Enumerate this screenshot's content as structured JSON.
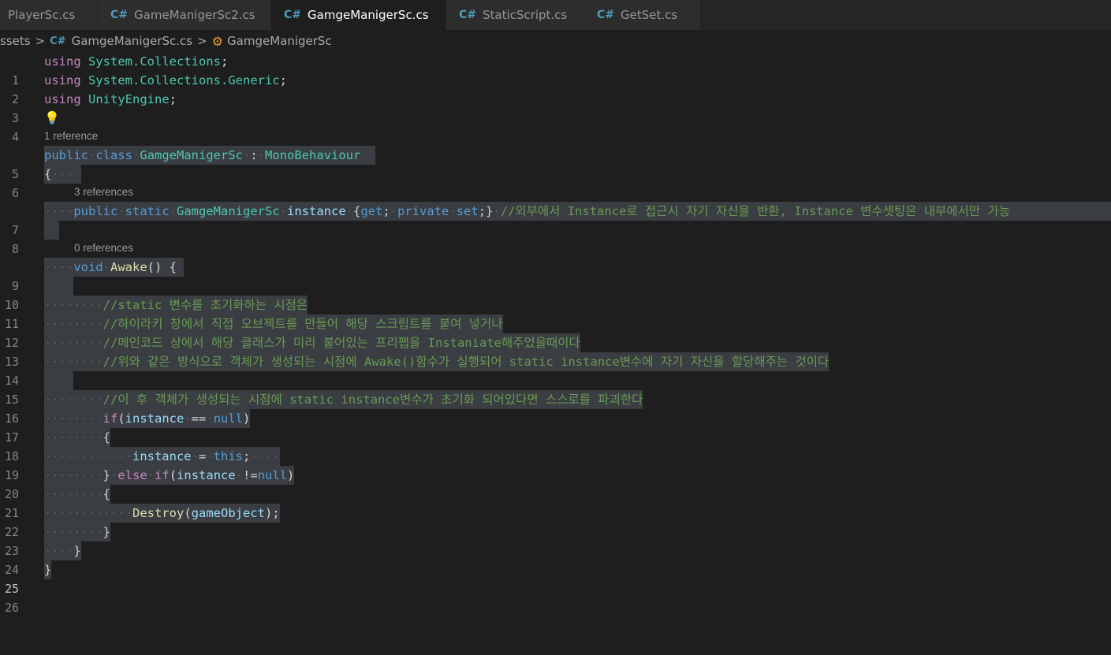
{
  "tabs": [
    {
      "label": "PlayerSc.cs",
      "active": false,
      "dirty": false
    },
    {
      "label": "GameManigerSc2.cs",
      "active": false,
      "dirty": true
    },
    {
      "label": "GamgeManigerSc.cs",
      "active": true,
      "dirty": true
    },
    {
      "label": "StaticScript.cs",
      "active": false,
      "dirty": true
    },
    {
      "label": "GetSet.cs",
      "active": false,
      "dirty": false
    }
  ],
  "file_icon": "C#",
  "breadcrumb": {
    "folder": "ssets",
    "file": "GamgeManigerSc.cs",
    "symbol": "GamgeManigerSc"
  },
  "codelens": {
    "class_refs": "1 reference",
    "instance_refs": "3 references",
    "awake_refs": "0 references"
  },
  "line_numbers": [
    "1",
    "2",
    "3",
    "4",
    "5",
    "6",
    "7",
    "8",
    "9",
    "10",
    "11",
    "12",
    "13",
    "14",
    "15",
    "16",
    "17",
    "18",
    "19",
    "20",
    "21",
    "22",
    "23",
    "24",
    "25",
    "26"
  ],
  "current_line": "25",
  "code": {
    "l1": {
      "kw": "using",
      "ns": "System.Collections",
      "end": ";"
    },
    "l2": {
      "kw": "using",
      "ns": "System.Collections.Generic",
      "end": ";"
    },
    "l3": {
      "kw": "using",
      "ns": "UnityEngine",
      "end": ";"
    },
    "l5": {
      "public": "public",
      "class": "class",
      "name": "GamgeManigerSc",
      "colon": ":",
      "base": "MonoBehaviour"
    },
    "l6": "{",
    "l7": {
      "public": "public",
      "static": "static",
      "type": "GamgeManigerSc",
      "field": "instance",
      "get": "get",
      "private": "private",
      "set": "set",
      "comment": "//외부에서 Instance로 접근시 자기 자신을 반환, Instance 변수셋팅은 내부에서만 가능"
    },
    "l9": {
      "void": "void",
      "name": "Awake",
      "rest": "() {"
    },
    "l11": "//static 변수를 초기화하는 시점은",
    "l12": "//하이라키 창에서 직접 오브젝트를 만들어 해당 스크립트를 붙여 넣거나",
    "l13": "//메인코드 상에서 해당 클래스가 미리 붙어있는 프리팹을 Instaniate해주었을때이다",
    "l14": "//위와 같은 방식으로 객체가 생성되는 시점에 Awake()함수가 실행되어 static instance변수에 자기 자신을 할당해주는 것이다",
    "l16": "//이 후 객체가 생성되는 시점에 static instance변수가 초기화 되어있다면 스스로를 파괴한다",
    "l17": {
      "if": "if",
      "var": "instance",
      "op": "==",
      "null": "null"
    },
    "l18": "{",
    "l19": {
      "var": "instance",
      "op": "=",
      "this": "this"
    },
    "l20": {
      "else": "else",
      "if": "if",
      "var": "instance",
      "op": "!=",
      "null": "null"
    },
    "l21": "{",
    "l22": {
      "fn": "Destroy",
      "arg": "gameObject"
    },
    "l23": "}",
    "l24": "}",
    "l25": "}"
  },
  "colors": {
    "background": "#1e1e1e",
    "selection": "#3a3d41",
    "keyword": "#569cd6",
    "control": "#c586c0",
    "type": "#4ec9b0",
    "function": "#dcdcaa",
    "variable": "#9cdcfe",
    "comment": "#6a9955"
  }
}
